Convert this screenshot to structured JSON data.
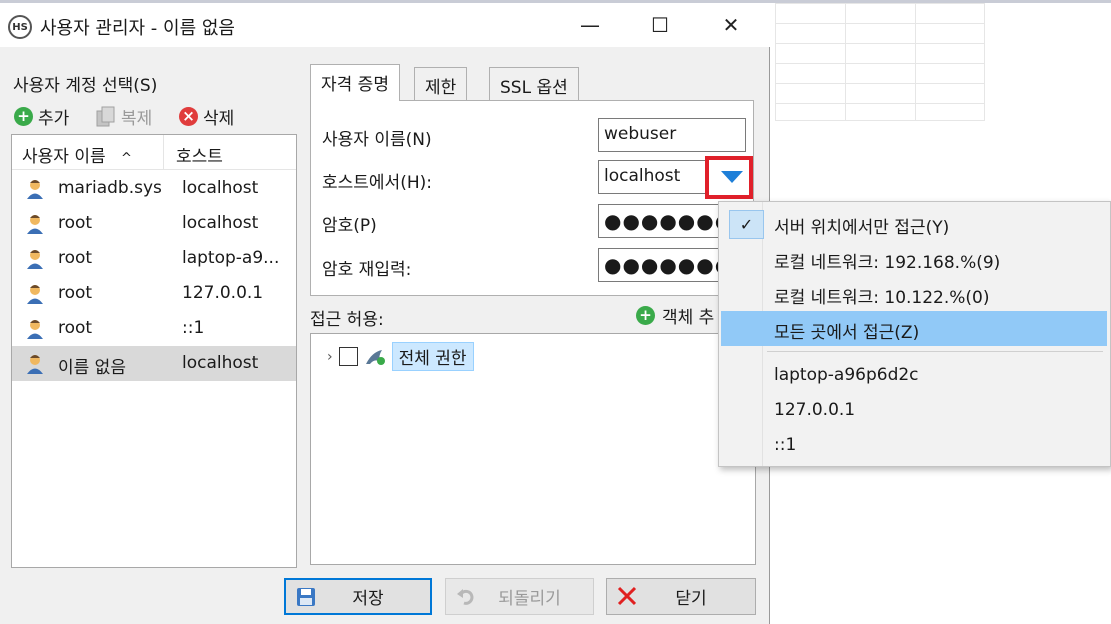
{
  "window": {
    "title": "사용자 관리자 - 이름 없음",
    "icon_text": "HS",
    "minimize": "—",
    "maximize": "☐",
    "close": "✕"
  },
  "left": {
    "account_label": "사용자 계정 선택(S)",
    "toolbar": {
      "add": "추가",
      "copy": "복제",
      "delete": "삭제"
    },
    "columns": {
      "user": "사용자 이름",
      "sort_indicator": "^",
      "host": "호스트"
    },
    "rows": [
      {
        "user": "mariadb.sys",
        "host": "localhost"
      },
      {
        "user": "root",
        "host": "localhost"
      },
      {
        "user": "root",
        "host": "laptop-a9..."
      },
      {
        "user": "root",
        "host": "127.0.0.1"
      },
      {
        "user": "root",
        "host": "::1"
      },
      {
        "user": "이름 없음",
        "host": "localhost"
      }
    ]
  },
  "tabs": [
    "자격 증명",
    "제한",
    "SSL 옵션"
  ],
  "credentials": {
    "username_label": "사용자 이름(N)",
    "username_value": "webuser",
    "host_label": "호스트에서(H):",
    "host_value": "localhost",
    "password_label": "암호(P)",
    "password_mask": "●●●●●●●",
    "repeat_label": "암호 재입력:",
    "repeat_mask": "●●●●●●●●"
  },
  "access": {
    "label": "접근 허용:",
    "object_button": "객체 추",
    "tree_chevron": "›",
    "all_privileges": "전체 권한"
  },
  "buttons": {
    "save": "저장",
    "revert": "되돌리기",
    "close": "닫기"
  },
  "host_menu": {
    "items": [
      {
        "label": "서버 위치에서만 접근(Y)",
        "checked": true
      },
      {
        "label": "로컬 네트워크: 192.168.%(9)"
      },
      {
        "label": "로컬 네트워크: 10.122.%(0)"
      },
      {
        "label": "모든 곳에서 접근(Z)",
        "highlighted": true
      },
      {
        "label": "laptop-a96p6d2c"
      },
      {
        "label": "127.0.0.1"
      },
      {
        "label": "::1"
      }
    ],
    "check_glyph": "✓"
  },
  "colors": {
    "accent_blue": "#1e7fd8",
    "highlight_red": "#e03c3c",
    "add_green": "#3aaa4a",
    "menu_highlight": "#91c9f7"
  }
}
